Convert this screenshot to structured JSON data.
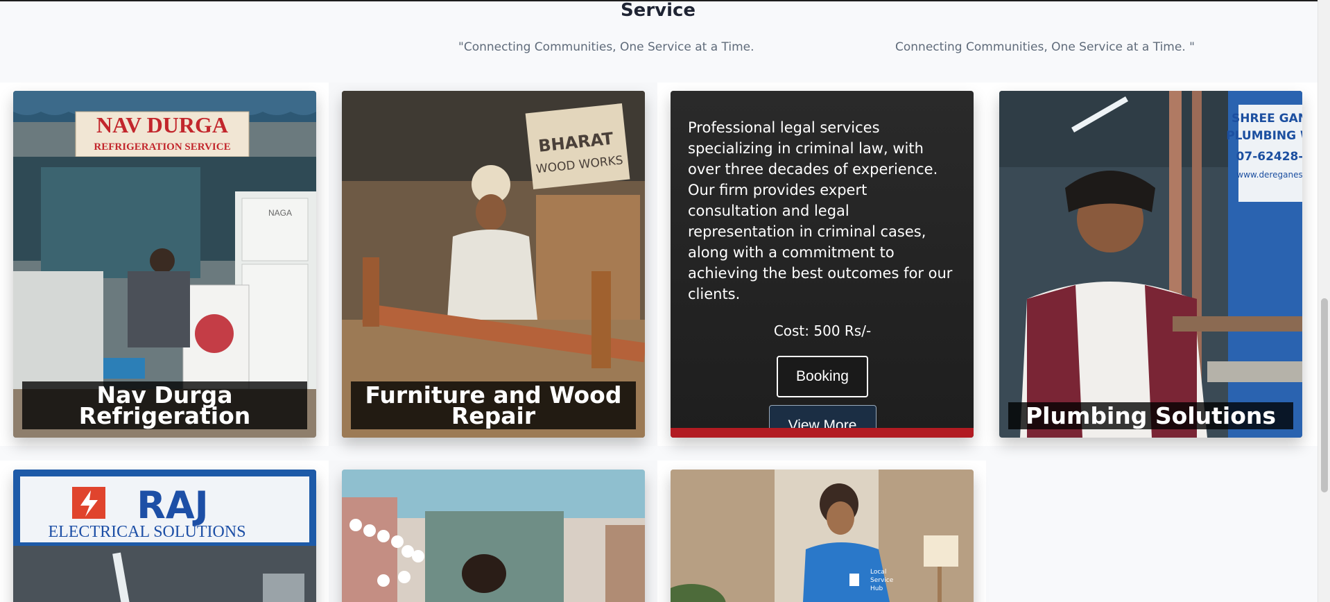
{
  "section": {
    "title": "Service",
    "tagline_left": "\"Connecting Communities, One Service at a Time.",
    "tagline_right": "Connecting Communities, One Service at a Time. \""
  },
  "cards": [
    {
      "title": "Nav Durga Refrigeration",
      "sign_line1": "NAV DURGA",
      "sign_line2": "REFRIGERATION SERVICE",
      "appliance_brand": "NAGA"
    },
    {
      "title": "Furniture and Wood Repair",
      "sign_line1": "BHARAT",
      "sign_line2": "WOOD WORKS"
    },
    {
      "description": "Professional legal services specializing in criminal law, with over three decades of experience. Our firm provides expert consultation and legal representation in criminal cases, along with a commitment to achieving the best outcomes for our clients.",
      "cost": "Cost: 500 Rs/-",
      "booking_label": "Booking",
      "view_more_label": "View More"
    },
    {
      "title": "Plumbing Solutions",
      "sign_line1": "SHREE GAN",
      "sign_line2": "PLUMBING W",
      "sign_line3": "07-62428-",
      "sign_line4": "www.dereganes"
    },
    {
      "sign_line1": "RAJ",
      "sign_line2": "ELECTRICAL SOLUTIONS"
    },
    {},
    {
      "shirt_text_1": "Local",
      "shirt_text_2": "Service",
      "shirt_text_3": "Hub"
    }
  ],
  "colors": {
    "page_bg": "#f8f9fb",
    "card_overlay_bg": "#222222",
    "view_more_bg": "#1b2e44",
    "title_band_bg": "#000000"
  }
}
